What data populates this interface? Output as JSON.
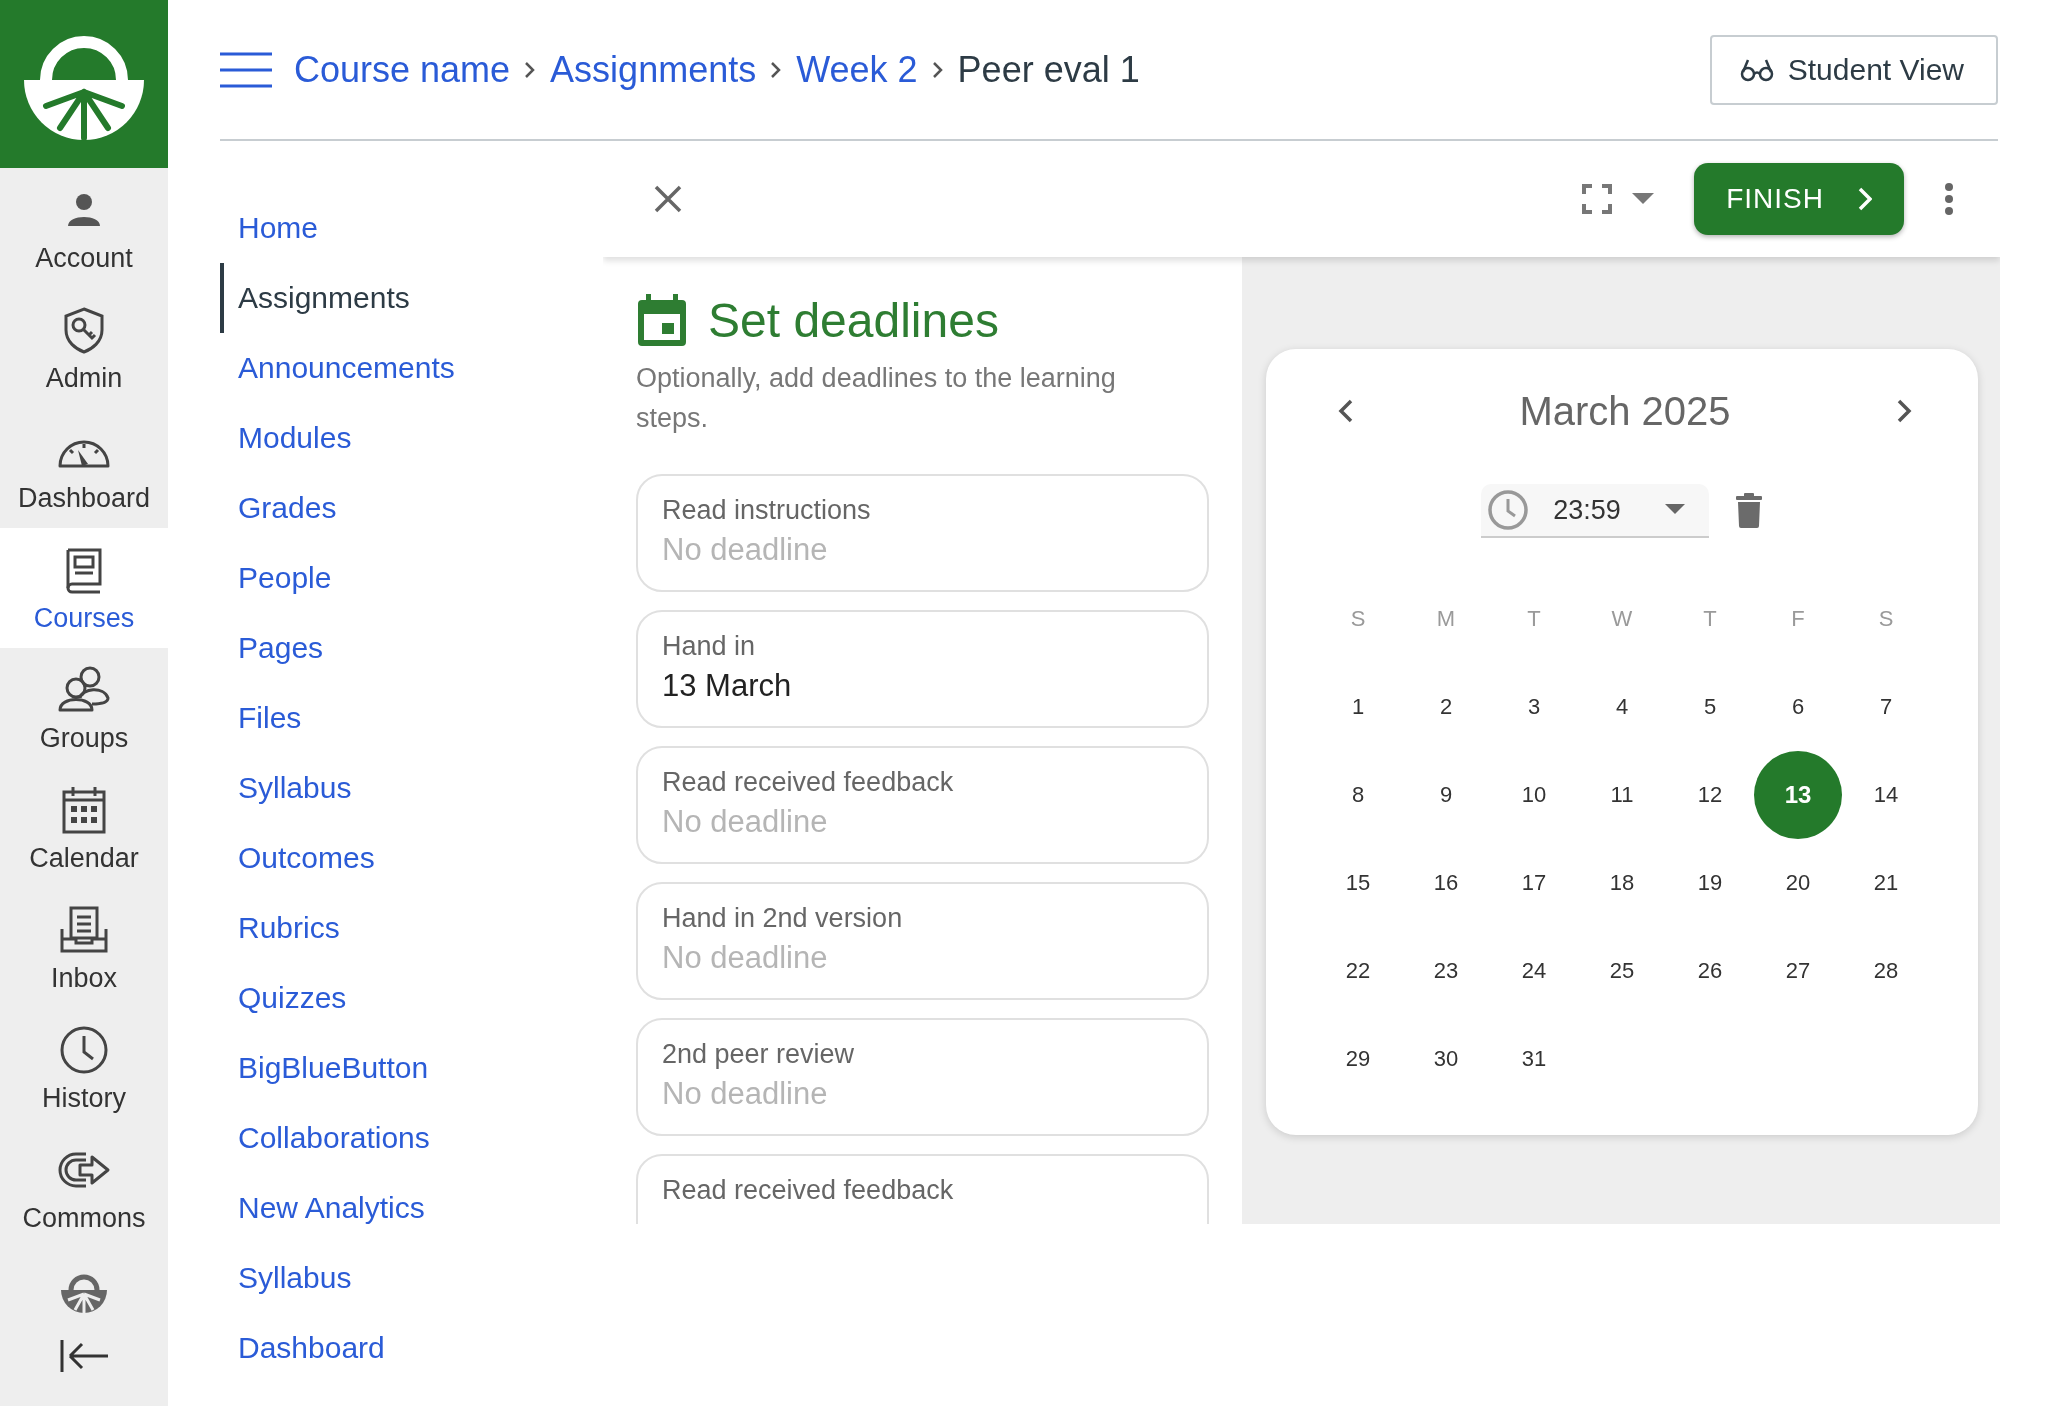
{
  "global_nav": [
    {
      "label": "Account",
      "kind": "person",
      "selected": false
    },
    {
      "label": "Admin",
      "kind": "shield",
      "selected": false
    },
    {
      "label": "Dashboard",
      "kind": "gauge",
      "selected": false
    },
    {
      "label": "Courses",
      "kind": "book",
      "selected": true
    },
    {
      "label": "Groups",
      "kind": "people",
      "selected": false
    },
    {
      "label": "Calendar",
      "kind": "calendar",
      "selected": false
    },
    {
      "label": "Inbox",
      "kind": "inbox",
      "selected": false
    },
    {
      "label": "History",
      "kind": "clock",
      "selected": false
    },
    {
      "label": "Commons",
      "kind": "commons",
      "selected": false
    }
  ],
  "breadcrumb": [
    {
      "label": "Course name",
      "link": true
    },
    {
      "label": "Assignments",
      "link": true
    },
    {
      "label": "Week 2",
      "link": true
    },
    {
      "label": "Peer eval 1",
      "link": false
    }
  ],
  "student_view_button": "Student View",
  "course_nav": [
    {
      "label": "Home",
      "selected": false
    },
    {
      "label": "Assignments",
      "selected": true
    },
    {
      "label": "Announcements",
      "selected": false
    },
    {
      "label": "Modules",
      "selected": false
    },
    {
      "label": "Grades",
      "selected": false
    },
    {
      "label": "People",
      "selected": false
    },
    {
      "label": "Pages",
      "selected": false
    },
    {
      "label": "Files",
      "selected": false
    },
    {
      "label": "Syllabus",
      "selected": false
    },
    {
      "label": "Outcomes",
      "selected": false
    },
    {
      "label": "Rubrics",
      "selected": false
    },
    {
      "label": "Quizzes",
      "selected": false
    },
    {
      "label": "BigBlueButton",
      "selected": false
    },
    {
      "label": "Collaborations",
      "selected": false
    },
    {
      "label": "New Analytics",
      "selected": false
    },
    {
      "label": "Syllabus",
      "selected": false
    },
    {
      "label": "Dashboard",
      "selected": false
    }
  ],
  "toolbar": {
    "finish_button": "FINISH"
  },
  "step": {
    "title": "Set deadlines",
    "description": "Optionally, add deadlines to the learning steps.",
    "deadlines": [
      {
        "label": "Read instructions",
        "value": "No deadline",
        "set": false
      },
      {
        "label": "Hand in",
        "value": "13 March",
        "set": true
      },
      {
        "label": "Read received feedback",
        "value": "No deadline",
        "set": false
      },
      {
        "label": "Hand in 2nd version",
        "value": "No deadline",
        "set": false
      },
      {
        "label": "2nd peer review",
        "value": "No deadline",
        "set": false
      },
      {
        "label": "Read received feedback"
      }
    ]
  },
  "date_picker": {
    "month": "March 2025",
    "time": "23:59",
    "weekdays": [
      "S",
      "M",
      "T",
      "W",
      "T",
      "F",
      "S"
    ],
    "days": [
      {
        "label": "1",
        "selected": false
      },
      {
        "label": "2",
        "selected": false
      },
      {
        "label": "3",
        "selected": false
      },
      {
        "label": "4",
        "selected": false
      },
      {
        "label": "5",
        "selected": false
      },
      {
        "label": "6",
        "selected": false
      },
      {
        "label": "7",
        "selected": false
      },
      {
        "label": "8",
        "selected": false
      },
      {
        "label": "9",
        "selected": false
      },
      {
        "label": "10",
        "selected": false
      },
      {
        "label": "11",
        "selected": false
      },
      {
        "label": "12",
        "selected": false
      },
      {
        "label": "13",
        "selected": true
      },
      {
        "label": "14",
        "selected": false
      },
      {
        "label": "15",
        "selected": false
      },
      {
        "label": "16",
        "selected": false
      },
      {
        "label": "17",
        "selected": false
      },
      {
        "label": "18",
        "selected": false
      },
      {
        "label": "19",
        "selected": false
      },
      {
        "label": "20",
        "selected": false
      },
      {
        "label": "21",
        "selected": false
      },
      {
        "label": "22",
        "selected": false
      },
      {
        "label": "23",
        "selected": false
      },
      {
        "label": "24",
        "selected": false
      },
      {
        "label": "25",
        "selected": false
      },
      {
        "label": "26",
        "selected": false
      },
      {
        "label": "27",
        "selected": false
      },
      {
        "label": "28",
        "selected": false
      },
      {
        "label": "29",
        "selected": false
      },
      {
        "label": "30",
        "selected": false
      },
      {
        "label": "31",
        "selected": false
      }
    ]
  }
}
